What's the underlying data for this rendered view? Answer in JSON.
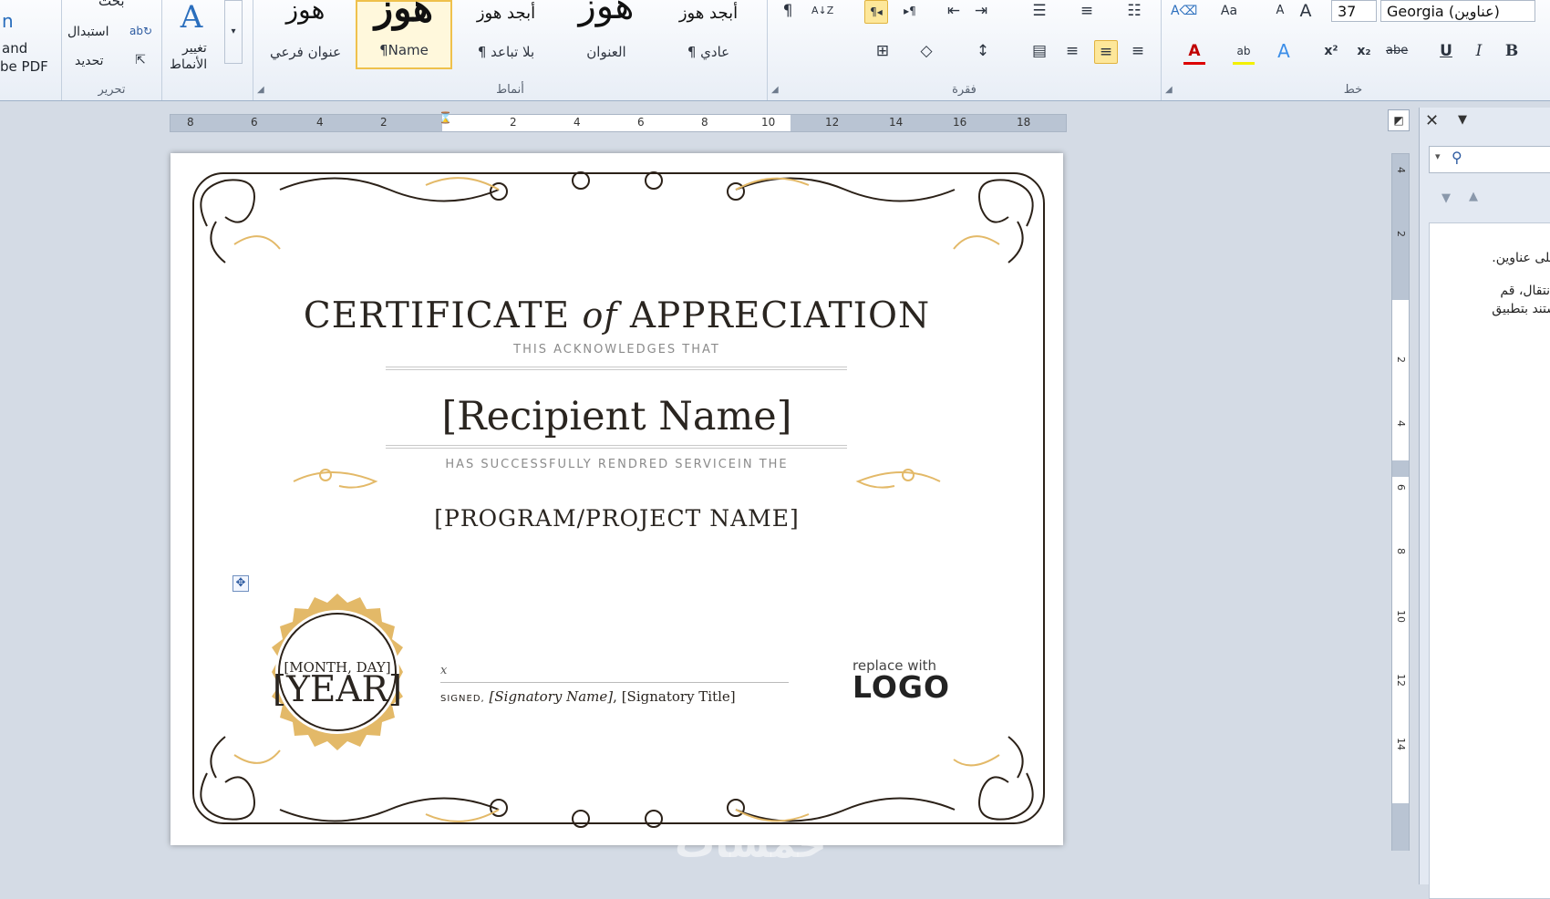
{
  "ribbon": {
    "left_partial": {
      "line1": "and",
      "line2": "be PDF",
      "icon": "n"
    },
    "edit_group": {
      "label": "تحرير",
      "find": "بحث",
      "replace": "استبدال",
      "select": "تحديد"
    },
    "change_styles": {
      "line1": "تغيير",
      "line2": "الأنماط"
    },
    "styles_group": {
      "label": "أنماط",
      "styles": [
        {
          "preview": "هوز",
          "label": "عنوان فرعي"
        },
        {
          "preview": "هوز",
          "label": "¶Name"
        },
        {
          "preview": "أبجد هوز",
          "label": "¶ بلا تباعد"
        },
        {
          "preview": "هوز",
          "label": "العنوان"
        },
        {
          "preview": "أبجد هوز",
          "label": "¶ عادي"
        }
      ]
    },
    "paragraph_group": {
      "label": "فقرة"
    },
    "font_group": {
      "label": "خط",
      "font_name": "Georgia (عناوين)",
      "font_size": "37"
    },
    "icons": {
      "pilcrow": "¶",
      "sort": "A↓Z",
      "ltr": "¶◂",
      "rtl": "▸¶",
      "bold": "B",
      "italic": "I",
      "underline": "U",
      "strike": "abe",
      "subscript": "x₂",
      "superscript": "x²",
      "grow": "A",
      "shrink": "A",
      "case": "Aa"
    }
  },
  "ruler": {
    "h_numbers": [
      "8",
      "6",
      "4",
      "2",
      "2",
      "4",
      "6",
      "8",
      "10",
      "12",
      "14",
      "16",
      "18"
    ],
    "v_numbers": [
      "4",
      "2",
      "2",
      "4",
      "6",
      "8",
      "10",
      "12",
      "14"
    ]
  },
  "pane": {
    "line1": "على عناوين.",
    "line2": "لانتقال، قم",
    "line3": "ستند بتطبيق"
  },
  "certificate": {
    "title_a": "CERTIFICATE",
    "title_of": "of",
    "title_b": "APPRECIATION",
    "acknowledges": "THIS ACKNOWLEDGES THAT",
    "recipient": "[Recipient Name]",
    "rendered": "HAS SUCCESSFULLY RENDRED SERVICEIN THE",
    "program": "[PROGRAM/PROJECT NAME]",
    "seal_line1": "[MONTH, DAY]",
    "seal_line2": "[YEAR]",
    "sig_x": "x",
    "signed_label": "SIGNED,",
    "signatory_name": "[Signatory Name]",
    "signatory_sep": ",",
    "signatory_title": "[Signatory Title]",
    "logo_small": "replace with",
    "logo_big": "LOGO"
  },
  "watermark": "خمسات",
  "colors": {
    "gold": "#e3b968",
    "frame": "#2b2118",
    "highlight": "#fde79a",
    "ribbon_border": "#9fb1c8"
  }
}
